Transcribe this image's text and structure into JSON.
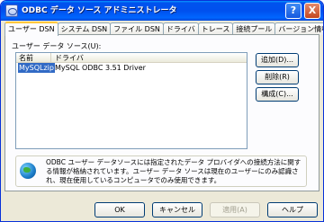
{
  "window": {
    "title": "ODBC データ ソース アドミニストレータ",
    "help_label": "?",
    "close_label": "X"
  },
  "tabs": [
    {
      "label": "ユーザー DSN",
      "active": true
    },
    {
      "label": "システム DSN"
    },
    {
      "label": "ファイル DSN"
    },
    {
      "label": "ドライバ"
    },
    {
      "label": "トレース"
    },
    {
      "label": "接続プール"
    },
    {
      "label": "バージョン情報"
    }
  ],
  "section_label": "ユーザー データ ソース(U):",
  "list": {
    "columns": [
      "名前",
      "ドライバ"
    ],
    "rows": [
      {
        "name": "MySQLzip",
        "driver": "MySQL ODBC 3.51 Driver",
        "selected": true
      }
    ]
  },
  "side_buttons": {
    "add": "追加(D)...",
    "remove": "削除(R)",
    "configure": "構成(C)..."
  },
  "info": {
    "icon": "globe-icon",
    "text": "ODBC ユーザー データソースには指定されたデータ プロバイダへの接続方法に関する情報が格納されています。ユーザー データ ソースは現在のユーザーにのみ認識され、現在使用しているコンピュータでのみ使用できます。"
  },
  "bottom_buttons": {
    "ok": "OK",
    "cancel": "キャンセル",
    "apply": "適用(A)",
    "help": "ヘルプ"
  }
}
